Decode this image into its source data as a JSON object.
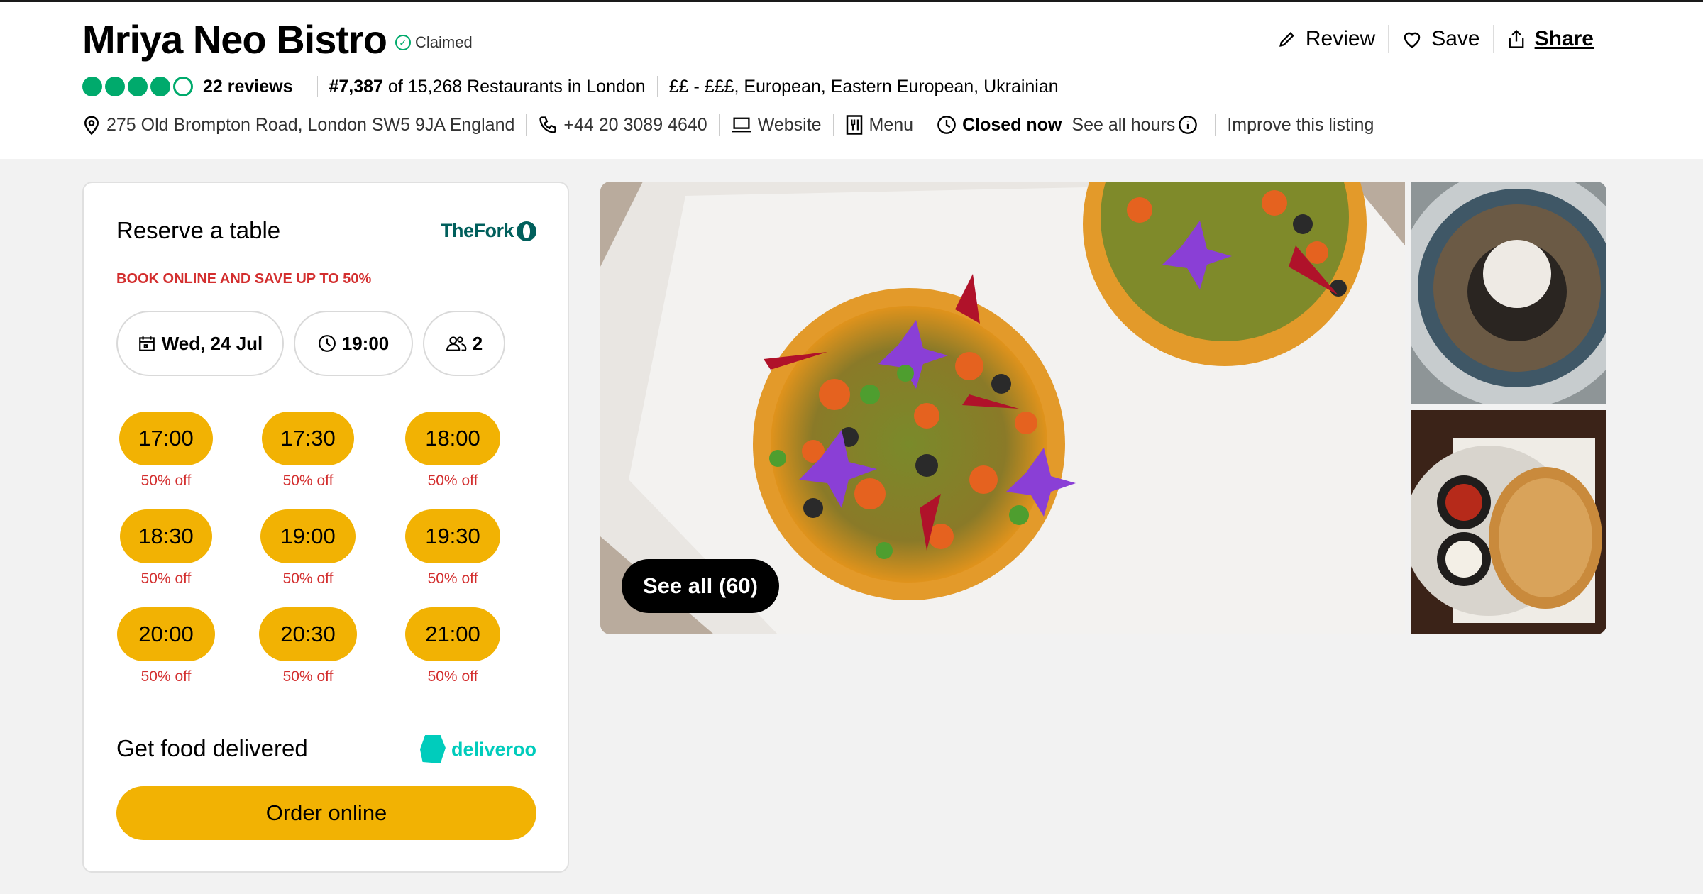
{
  "restaurant": {
    "name": "Mriya Neo Bistro",
    "claimed": "Claimed",
    "rating_bubbles": 4,
    "reviews": "22 reviews",
    "rank_number": "#7,387",
    "rank_text": "of 15,268 Restaurants in London",
    "price_cuisines": "££ - £££, European, Eastern European, Ukrainian",
    "address": "275 Old Brompton Road, London SW5 9JA England",
    "phone": "+44 20 3089 4640",
    "website": "Website",
    "menu": "Menu",
    "status": "Closed now",
    "hours_link": "See all hours",
    "improve": "Improve this listing"
  },
  "actions": {
    "review": "Review",
    "save": "Save",
    "share": "Share"
  },
  "reserve": {
    "title": "Reserve a table",
    "partner": "TheFork",
    "promo": "BOOK ONLINE AND SAVE UP TO 50%",
    "date": "Wed, 24 Jul",
    "time": "19:00",
    "party": "2",
    "slots": [
      {
        "time": "17:00",
        "off": "50% off"
      },
      {
        "time": "17:30",
        "off": "50% off"
      },
      {
        "time": "18:00",
        "off": "50% off"
      },
      {
        "time": "18:30",
        "off": "50% off"
      },
      {
        "time": "19:00",
        "off": "50% off"
      },
      {
        "time": "19:30",
        "off": "50% off"
      },
      {
        "time": "20:00",
        "off": "50% off"
      },
      {
        "time": "20:30",
        "off": "50% off"
      },
      {
        "time": "21:00",
        "off": "50% off"
      }
    ]
  },
  "delivery": {
    "title": "Get food delivered",
    "partner": "deliveroo",
    "order_button": "Order online"
  },
  "gallery": {
    "see_all": "See all (60)"
  },
  "colors": {
    "bubble_green": "#00aa6c",
    "slot_yellow": "#f2b203",
    "promo_red": "#d32f2f",
    "thefork_teal": "#005f5c",
    "deliveroo_teal": "#00ccbc"
  }
}
